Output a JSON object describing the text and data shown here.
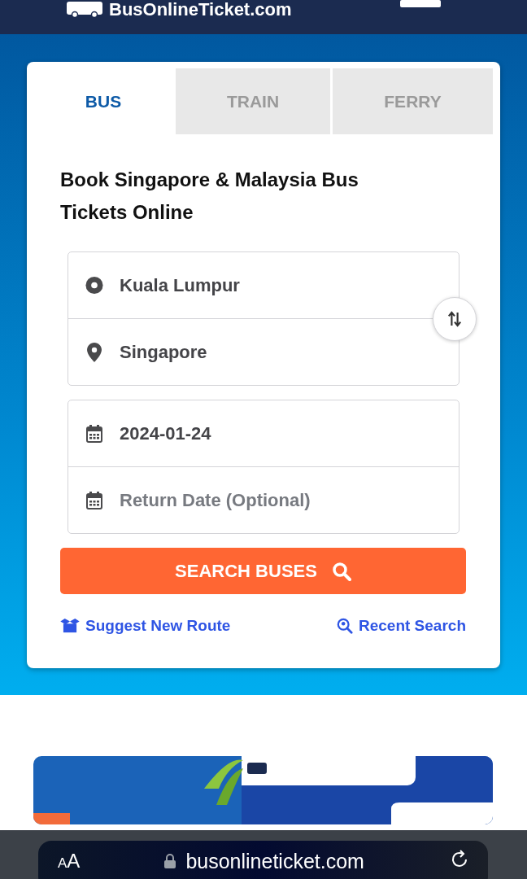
{
  "header": {
    "logo": "BusOnlineTicket.com"
  },
  "tabs": [
    {
      "label": "BUS",
      "selected": true
    },
    {
      "label": "TRAIN",
      "selected": false
    },
    {
      "label": "FERRY",
      "selected": false
    }
  ],
  "heading": "Book Singapore & Malaysia Bus Tickets Online",
  "route": [
    {
      "kind": "origin",
      "value": "Kuala Lumpur"
    },
    {
      "kind": "destination",
      "value": "Singapore"
    }
  ],
  "dates": [
    {
      "value": "2024-01-24"
    },
    {
      "placeholder": "Return Date (Optional)"
    }
  ],
  "search_button": "SEARCH BUSES",
  "links": [
    {
      "kind": "suggest",
      "label": "Suggest New Route"
    },
    {
      "kind": "recent",
      "label": "Recent Search"
    }
  ],
  "browser_bar": {
    "text_size": "AA",
    "url": "busonlineticket.com"
  }
}
